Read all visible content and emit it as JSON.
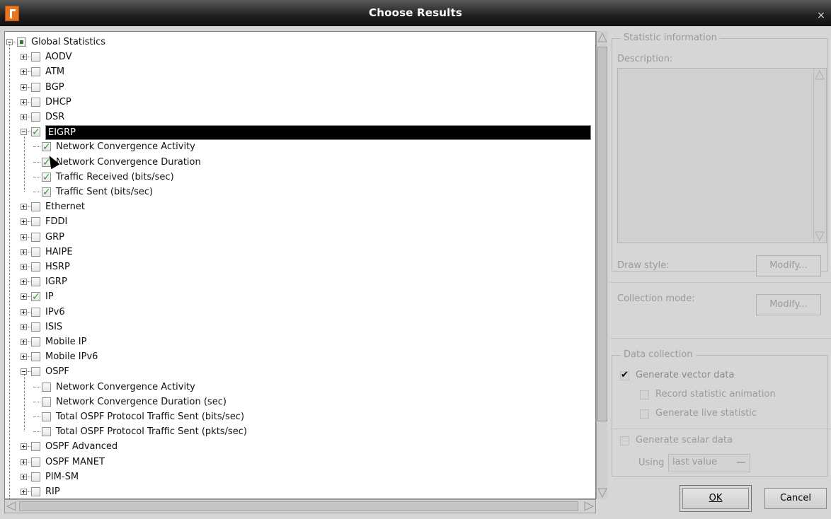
{
  "window": {
    "title": "Choose Results",
    "close_glyph": "×",
    "app_icon": "r-app-icon"
  },
  "tree": [
    {
      "label": "Global Statistics",
      "level": 0,
      "expander": "minus",
      "check": "dot"
    },
    {
      "label": "AODV",
      "level": 1,
      "expander": "plus",
      "check": "none"
    },
    {
      "label": "ATM",
      "level": 1,
      "expander": "plus",
      "check": "none"
    },
    {
      "label": "BGP",
      "level": 1,
      "expander": "plus",
      "check": "none"
    },
    {
      "label": "DHCP",
      "level": 1,
      "expander": "plus",
      "check": "none"
    },
    {
      "label": "DSR",
      "level": 1,
      "expander": "plus",
      "check": "none"
    },
    {
      "label": "EIGRP",
      "level": 1,
      "expander": "minus",
      "check": "checked",
      "selected": true
    },
    {
      "label": "Network Convergence Activity",
      "level": 2,
      "expander": "",
      "check": "checked"
    },
    {
      "label": "Network Convergence Duration",
      "level": 2,
      "expander": "",
      "check": "checked"
    },
    {
      "label": "Traffic Received (bits/sec)",
      "level": 2,
      "expander": "",
      "check": "checked"
    },
    {
      "label": "Traffic Sent (bits/sec)",
      "level": 2,
      "expander": "",
      "check": "checked"
    },
    {
      "label": "Ethernet",
      "level": 1,
      "expander": "plus",
      "check": "none"
    },
    {
      "label": "FDDI",
      "level": 1,
      "expander": "plus",
      "check": "none"
    },
    {
      "label": "GRP",
      "level": 1,
      "expander": "plus",
      "check": "none"
    },
    {
      "label": "HAIPE",
      "level": 1,
      "expander": "plus",
      "check": "none"
    },
    {
      "label": "HSRP",
      "level": 1,
      "expander": "plus",
      "check": "none"
    },
    {
      "label": "IGRP",
      "level": 1,
      "expander": "plus",
      "check": "none"
    },
    {
      "label": "IP",
      "level": 1,
      "expander": "plus",
      "check": "checked"
    },
    {
      "label": "IPv6",
      "level": 1,
      "expander": "plus",
      "check": "none"
    },
    {
      "label": "ISIS",
      "level": 1,
      "expander": "plus",
      "check": "none"
    },
    {
      "label": "Mobile IP",
      "level": 1,
      "expander": "plus",
      "check": "none"
    },
    {
      "label": "Mobile IPv6",
      "level": 1,
      "expander": "plus",
      "check": "none"
    },
    {
      "label": "OSPF",
      "level": 1,
      "expander": "minus",
      "check": "none"
    },
    {
      "label": "Network Convergence Activity",
      "level": 2,
      "expander": "",
      "check": "none"
    },
    {
      "label": "Network Convergence Duration (sec)",
      "level": 2,
      "expander": "",
      "check": "none"
    },
    {
      "label": "Total OSPF Protocol Traffic Sent (bits/sec)",
      "level": 2,
      "expander": "",
      "check": "none"
    },
    {
      "label": "Total OSPF Protocol Traffic Sent (pkts/sec)",
      "level": 2,
      "expander": "",
      "check": "none"
    },
    {
      "label": "OSPF Advanced",
      "level": 1,
      "expander": "plus",
      "check": "none"
    },
    {
      "label": "OSPF MANET",
      "level": 1,
      "expander": "plus",
      "check": "none"
    },
    {
      "label": "PIM-SM",
      "level": 1,
      "expander": "plus",
      "check": "none"
    },
    {
      "label": "RIP",
      "level": 1,
      "expander": "plus",
      "check": "none"
    }
  ],
  "info": {
    "group_label": "Statistic information",
    "description_label": "Description:",
    "draw_style_label": "Draw style:",
    "draw_modify": "Modify...",
    "collection_mode_label": "Collection mode:",
    "collection_modify": "Modify..."
  },
  "data_collection": {
    "group_label": "Data collection",
    "generate_vector": "Generate vector data",
    "generate_vector_checked": true,
    "record_animation": "Record statistic animation",
    "generate_live": "Generate live statistic",
    "generate_scalar": "Generate scalar data",
    "using_label": "Using",
    "using_value": "last value"
  },
  "footer": {
    "ok": "OK",
    "cancel": "Cancel"
  }
}
